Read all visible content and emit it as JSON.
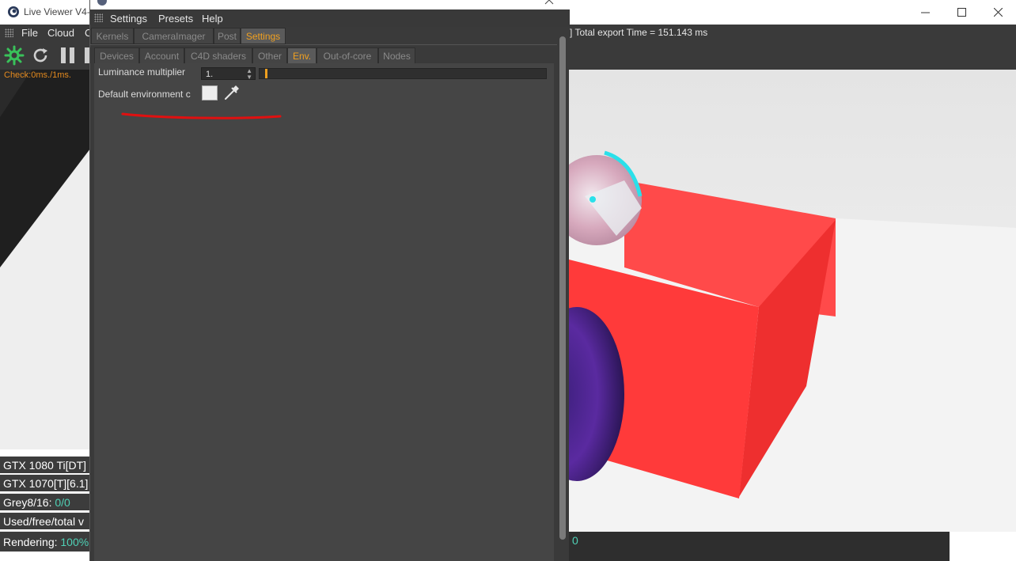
{
  "live_viewer": {
    "title": "Live Viewer V4-",
    "menu": [
      "File",
      "Cloud",
      "C"
    ],
    "export_text": "] Total export Time = 151.143 ms",
    "check_text": "Check:0ms./1ms.",
    "window_controls": [
      "minimize",
      "maximize",
      "close"
    ],
    "status": {
      "gpu1": "GTX 1080 Ti[DT]",
      "gpu2": "GTX 1070[T][6.1]",
      "grey_label": "Grey8/16: ",
      "grey_value": "0/0",
      "mem_label": "Used/free/total v",
      "rendering_label": "Rendering: ",
      "rendering_value": "100%",
      "right_value": "0"
    },
    "toolbar_icons": [
      "octane-logo-icon",
      "refresh-icon",
      "pause-icon"
    ]
  },
  "octane_settings": {
    "menu": [
      "Settings",
      "Presets",
      "Help"
    ],
    "main_tabs": [
      "Kernels",
      "CameraImager",
      "Post",
      "Settings"
    ],
    "main_active": "Settings",
    "sub_tabs": [
      "Devices",
      "Account",
      "C4D shaders",
      "Other",
      "Env.",
      "Out-of-core",
      "Nodes"
    ],
    "sub_active": "Env.",
    "luminance_label": "Luminance multiplier",
    "luminance_value": "1.",
    "luminance_fraction": 0.01,
    "default_env_label": "Default environment c",
    "default_env_color": "#ededed"
  },
  "colors": {
    "accent": "#f0a020",
    "teal": "#4fd1b6",
    "annotation": "#e01010",
    "cube": "#ff3a3a"
  }
}
